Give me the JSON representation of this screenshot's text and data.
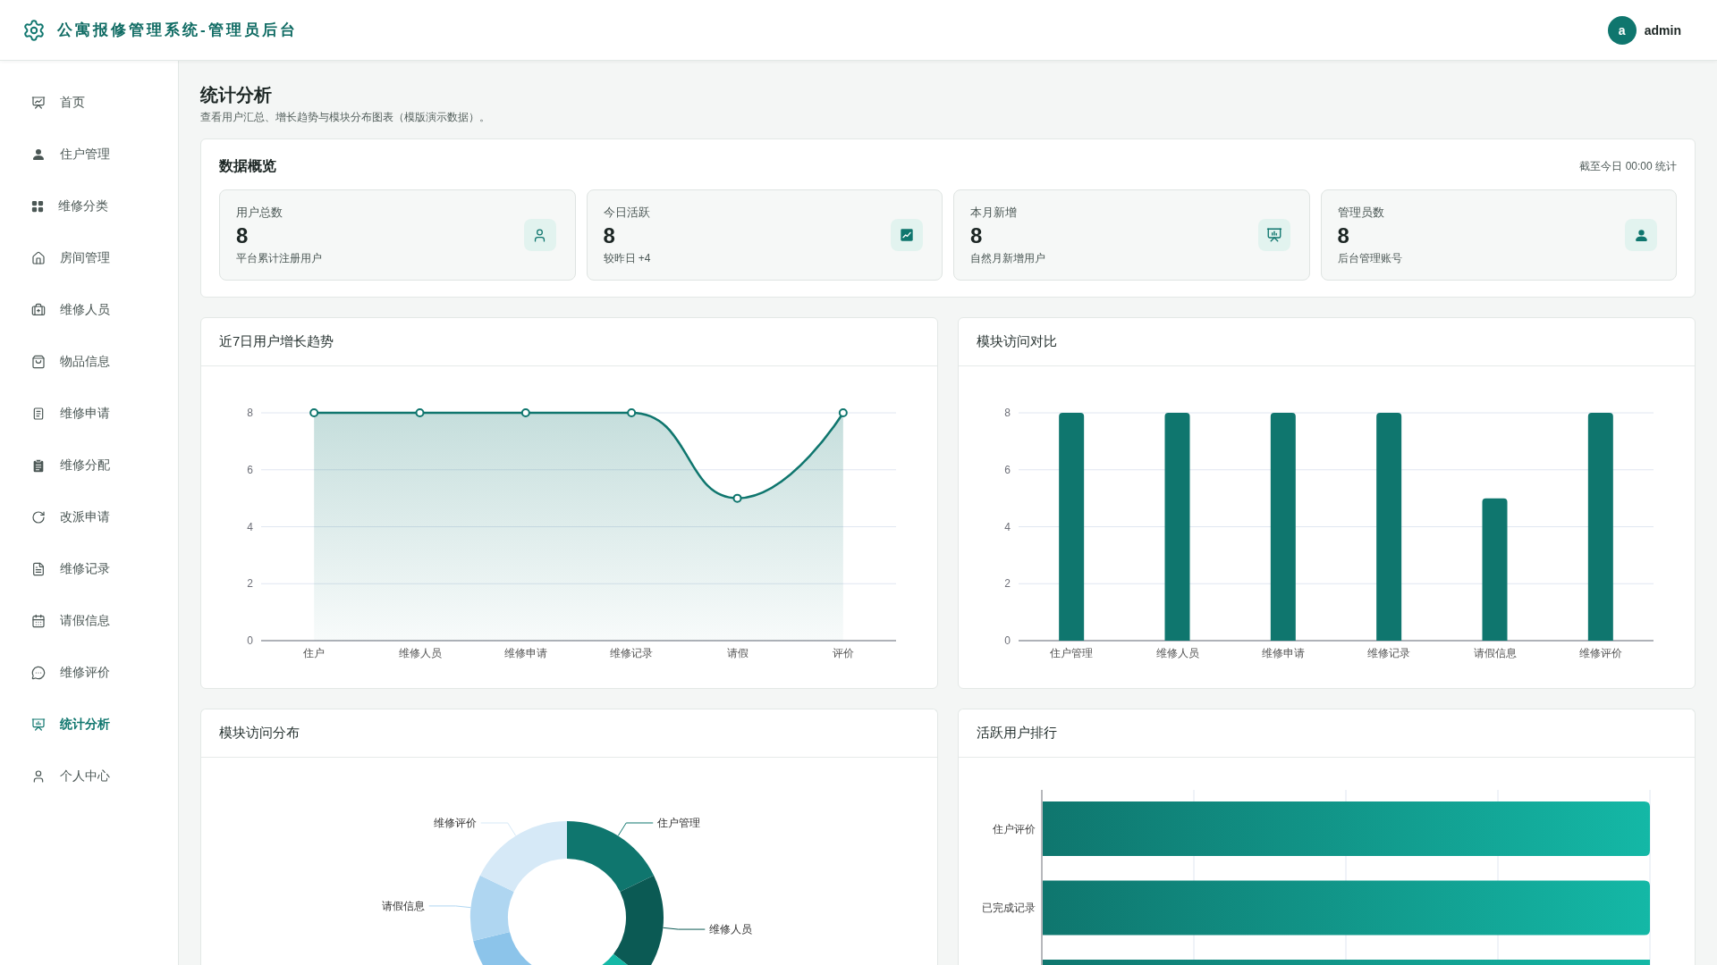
{
  "header": {
    "title": "公寓报修管理系统-管理员后台",
    "avatar": "a",
    "username": "admin"
  },
  "sidebar": {
    "items": [
      {
        "label": "首页",
        "selected": false
      },
      {
        "label": "住户管理",
        "selected": false
      },
      {
        "label": "维修分类",
        "selected": false
      },
      {
        "label": "房间管理",
        "selected": false
      },
      {
        "label": "维修人员",
        "selected": false
      },
      {
        "label": "物品信息",
        "selected": false
      },
      {
        "label": "维修申请",
        "selected": false
      },
      {
        "label": "维修分配",
        "selected": false
      },
      {
        "label": "改派申请",
        "selected": false
      },
      {
        "label": "维修记录",
        "selected": false
      },
      {
        "label": "请假信息",
        "selected": false
      },
      {
        "label": "维修评价",
        "selected": false
      },
      {
        "label": "统计分析",
        "selected": true
      },
      {
        "label": "个人中心",
        "selected": false
      }
    ]
  },
  "page": {
    "title": "统计分析",
    "subtitle": "查看用户汇总、增长趋势与模块分布图表（模版演示数据）。"
  },
  "overview": {
    "title": "数据概览",
    "note": "截至今日 00:00 统计",
    "cards": [
      {
        "label": "用户总数",
        "value": "8",
        "caption": "平台累计注册用户"
      },
      {
        "label": "今日活跃",
        "value": "8",
        "caption": "较昨日 +4"
      },
      {
        "label": "本月新增",
        "value": "8",
        "caption": "自然月新增用户"
      },
      {
        "label": "管理员数",
        "value": "8",
        "caption": "后台管理账号"
      }
    ]
  },
  "growth_trend": {
    "title": "近7日用户增长趋势",
    "chart_data": {
      "type": "area",
      "categories": [
        "住户",
        "维修人员",
        "维修申请",
        "维修记录",
        "请假",
        "评价"
      ],
      "values": [
        8,
        8,
        8,
        8,
        5,
        8
      ],
      "ylim": [
        0,
        8
      ],
      "yticks": [
        0,
        2,
        4,
        6,
        8
      ],
      "grid": true
    }
  },
  "module_comparison": {
    "title": "模块访问对比",
    "chart_data": {
      "type": "bar",
      "categories": [
        "住户管理",
        "维修人员",
        "维修申请",
        "维修记录",
        "请假信息",
        "维修评价"
      ],
      "values": [
        8,
        8,
        8,
        8,
        5,
        8
      ],
      "ylim": [
        0,
        8
      ],
      "yticks": [
        0,
        2,
        4,
        6,
        8
      ],
      "grid": true
    }
  },
  "module_distribution": {
    "title": "模块访问分布",
    "chart_data": {
      "type": "donut",
      "categories": [
        "住户管理",
        "维修人员",
        null,
        null,
        "请假信息",
        "维修评价"
      ],
      "values": [
        17.78,
        17.78,
        17.78,
        17.78,
        11.11,
        17.78
      ]
    }
  },
  "active_user_ranking": {
    "title": "活跃用户排行",
    "rows": [
      {
        "label": "住户评价"
      },
      {
        "label": "已完成记录"
      },
      {
        "label": null
      }
    ]
  }
}
